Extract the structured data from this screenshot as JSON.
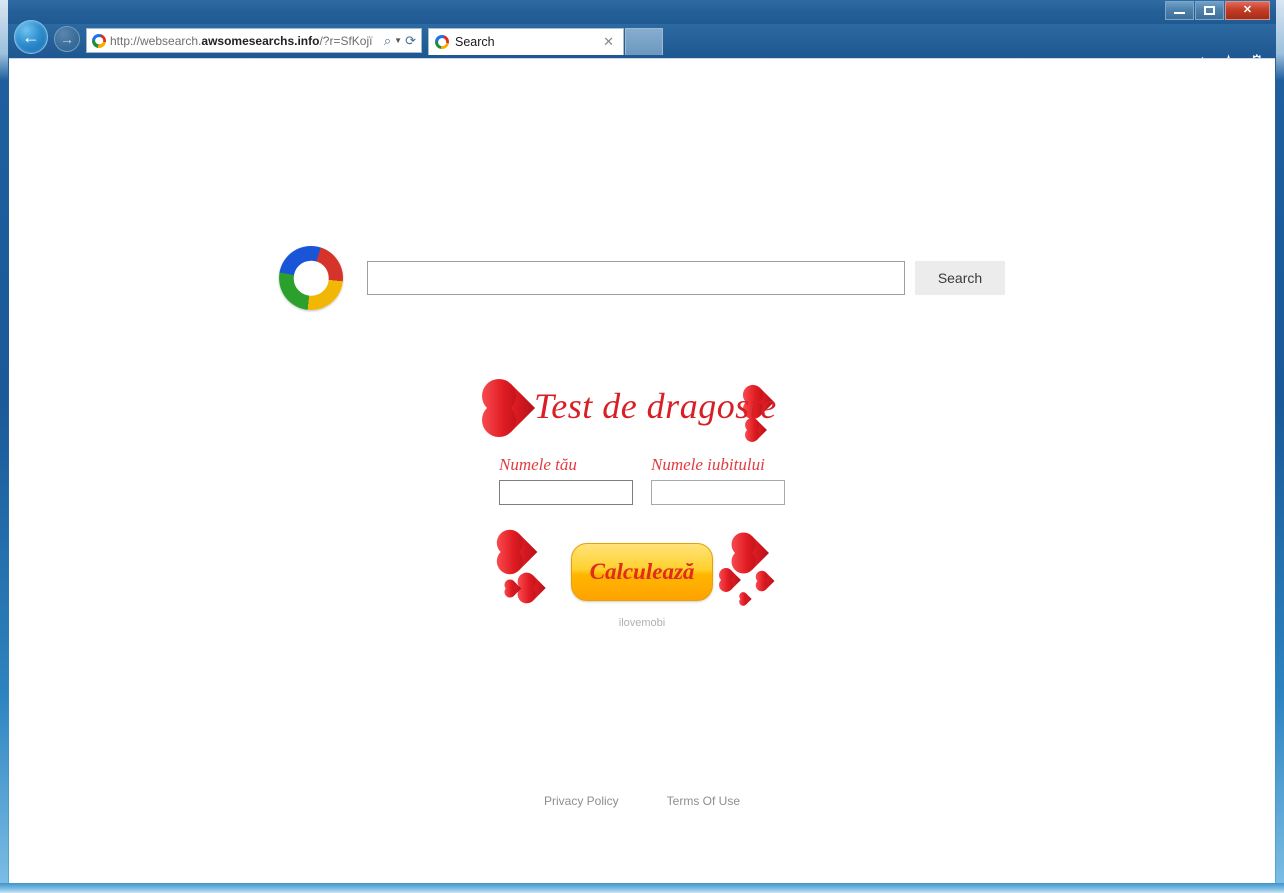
{
  "window": {
    "minimize_label": "Minimize",
    "maximize_label": "Maximize",
    "close_label": "✕"
  },
  "browser": {
    "back_arrow": "←",
    "forward_arrow": "→",
    "address": {
      "scheme": "http://websearch.",
      "domain": "awsomesearchs.info",
      "path": "/?r=SfKojï",
      "full": "http://websearch.awsomesearchs.info/?r=SfKojï",
      "search_icon": "⌕",
      "caret_icon": "▼",
      "refresh_icon": "⟳"
    },
    "tab": {
      "title": "Search",
      "close_label": "✕"
    },
    "toolbar_icons": {
      "home": "⌂",
      "favorites": "★",
      "tools": "⚙"
    }
  },
  "page": {
    "search": {
      "input_value": "",
      "placeholder": "",
      "button_label": "Search"
    },
    "love_test": {
      "title": "Test de dragoste",
      "your_name": {
        "label": "Numele tău",
        "value": "",
        "placeholder": ""
      },
      "partner_name": {
        "label": "Numele iubitului",
        "value": "",
        "placeholder": ""
      },
      "calculate_label": "Calculează",
      "brand": "ilovemobi"
    },
    "footer": {
      "privacy_policy": "Privacy Policy",
      "terms_of_use": "Terms Of Use"
    }
  },
  "colors": {
    "title_bar": "#1f5a93",
    "accent_red": "#e01b22",
    "button_yellow": "#ffc400",
    "link_gray": "#8e8e8e"
  }
}
